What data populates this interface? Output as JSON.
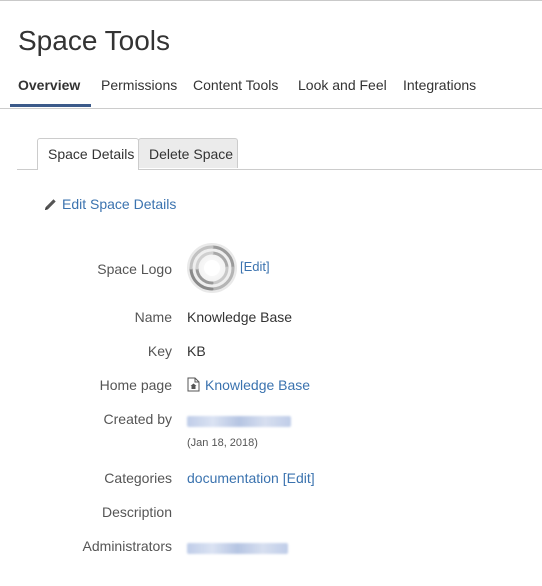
{
  "page": {
    "title": "Space Tools"
  },
  "main_tabs": [
    {
      "label": "Overview",
      "active": true
    },
    {
      "label": "Permissions",
      "active": false
    },
    {
      "label": "Content Tools",
      "active": false
    },
    {
      "label": "Look and Feel",
      "active": false
    },
    {
      "label": "Integrations",
      "active": false
    }
  ],
  "sub_tabs": [
    {
      "label": "Space Details",
      "active": true
    },
    {
      "label": "Delete Space",
      "active": false
    }
  ],
  "edit_space_details": {
    "label": "Edit Space Details",
    "icon": "pencil-icon"
  },
  "details": {
    "space_logo": {
      "label": "Space Logo",
      "edit": "[Edit]"
    },
    "name": {
      "label": "Name",
      "value": "Knowledge Base"
    },
    "key": {
      "label": "Key",
      "value": "KB"
    },
    "home_page": {
      "label": "Home page",
      "value": "Knowledge Base",
      "icon": "page-icon"
    },
    "created_by": {
      "label": "Created by",
      "date": "(Jan 18, 2018)"
    },
    "categories": {
      "label": "Categories",
      "value": "documentation",
      "edit": "[Edit]"
    },
    "description": {
      "label": "Description"
    },
    "administrators": {
      "label": "Administrators"
    }
  },
  "colors": {
    "link": "#3b73af",
    "active_tab_underline": "#3b5a8a",
    "border": "#cccccc"
  }
}
